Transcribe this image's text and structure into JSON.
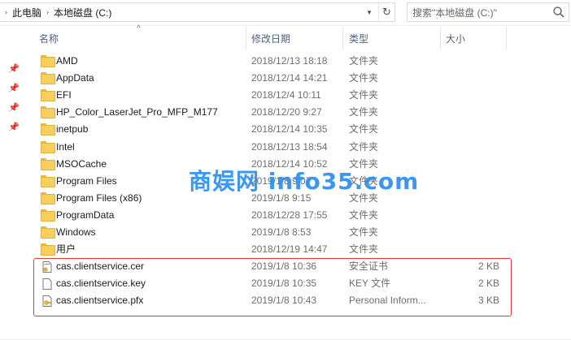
{
  "address": {
    "breadcrumb": [
      "此电脑",
      "本地磁盘 (C:)"
    ]
  },
  "search": {
    "placeholder": "搜索\"本地磁盘 (C:)\""
  },
  "columns": {
    "name": "名称",
    "date": "修改日期",
    "type": "类型",
    "size": "大小"
  },
  "watermark": "商娱网 info35.com",
  "files": [
    {
      "name": "AMD",
      "date": "2018/12/13 18:18",
      "type": "文件夹",
      "size": "",
      "icon": "folder-icon"
    },
    {
      "name": "AppData",
      "date": "2018/12/14 14:21",
      "type": "文件夹",
      "size": "",
      "icon": "folder-icon"
    },
    {
      "name": "EFI",
      "date": "2018/12/4 10:11",
      "type": "文件夹",
      "size": "",
      "icon": "folder-icon"
    },
    {
      "name": "HP_Color_LaserJet_Pro_MFP_M177",
      "date": "2018/12/20 9:27",
      "type": "文件夹",
      "size": "",
      "icon": "folder-icon"
    },
    {
      "name": "inetpub",
      "date": "2018/12/14 10:35",
      "type": "文件夹",
      "size": "",
      "icon": "folder-icon"
    },
    {
      "name": "Intel",
      "date": "2018/12/13 18:54",
      "type": "文件夹",
      "size": "",
      "icon": "folder-icon"
    },
    {
      "name": "MSOCache",
      "date": "2018/12/14 10:52",
      "type": "文件夹",
      "size": "",
      "icon": "folder-icon"
    },
    {
      "name": "Program Files",
      "date": "2019/1/8 9:07",
      "type": "文件夹",
      "size": "",
      "icon": "folder-icon"
    },
    {
      "name": "Program Files (x86)",
      "date": "2019/1/8 9:15",
      "type": "文件夹",
      "size": "",
      "icon": "folder-icon"
    },
    {
      "name": "ProgramData",
      "date": "2018/12/28 17:55",
      "type": "文件夹",
      "size": "",
      "icon": "folder-icon"
    },
    {
      "name": "Windows",
      "date": "2019/1/8 8:53",
      "type": "文件夹",
      "size": "",
      "icon": "folder-icon"
    },
    {
      "name": "用户",
      "date": "2018/12/19 14:47",
      "type": "文件夹",
      "size": "",
      "icon": "folder-icon"
    },
    {
      "name": "cas.clientservice.cer",
      "date": "2019/1/8 10:36",
      "type": "安全证书",
      "size": "2 KB",
      "icon": "certificate-icon"
    },
    {
      "name": "cas.clientservice.key",
      "date": "2019/1/8 10:35",
      "type": "KEY 文件",
      "size": "2 KB",
      "icon": "file-icon"
    },
    {
      "name": "cas.clientservice.pfx",
      "date": "2019/1/8 10:43",
      "type": "Personal Inform...",
      "size": "3 KB",
      "icon": "pfx-icon"
    }
  ],
  "colors": {
    "accent": "#2b8ff0",
    "highlight_box": "#e53935",
    "folder": "#f6cf5d"
  }
}
